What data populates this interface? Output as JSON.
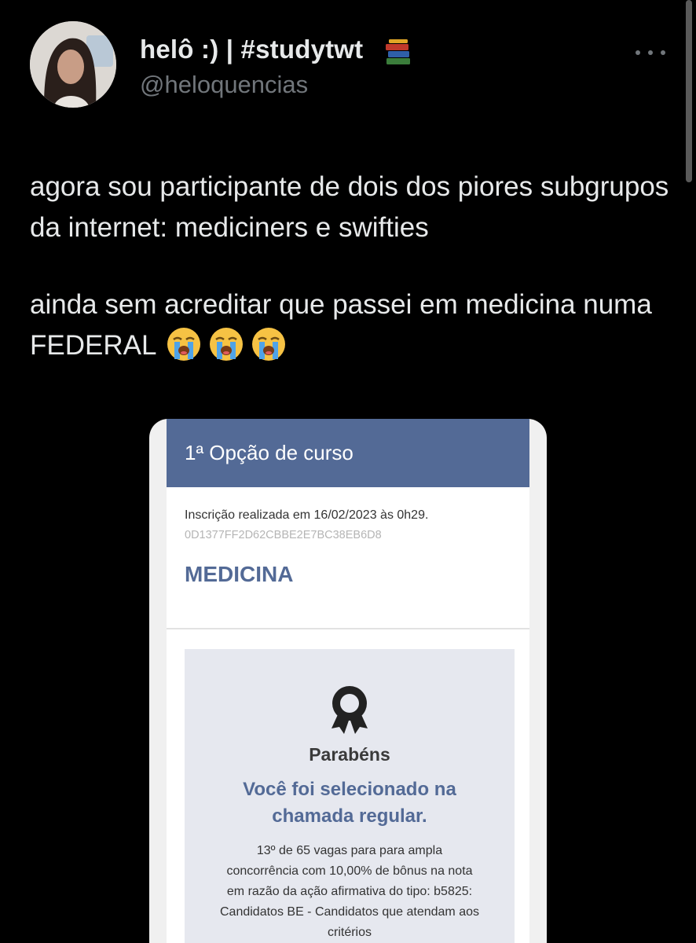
{
  "tweet": {
    "display_name": "helô :) | #studytwt",
    "handle": "@heloquencias",
    "icons": {
      "name_emoji": "books-icon",
      "menu": "more-options-icon",
      "emoji": "loudly-crying-face-icon"
    },
    "paragraph_1": "agora sou participante de dois dos piores subgrupos da internet: mediciners e swifties",
    "paragraph_2": "ainda sem acreditar que passei em medicina numa FEDERAL",
    "emoji_count": 3
  },
  "card": {
    "header_title": "1ª Opção de curso",
    "enrollment_text": "Inscrição realizada em 16/02/2023 às 0h29.",
    "hash": "0D1377FF2D62CBBE2E7BC38EB6D8",
    "course": "MEDICINA",
    "result": {
      "icon": "award-ribbon-icon",
      "congrats": "Parabéns",
      "message": "Você foi selecionado na chamada regular.",
      "details": "13º de 65 vagas para para ampla concorrência com 10,00% de bônus na nota em razão da ação afirmativa do tipo: b5825: Candidatos BE - Candidatos que atendam aos critérios"
    }
  },
  "colors": {
    "background": "#000000",
    "text": "#e7e9ea",
    "muted": "#71767b",
    "card_accent": "#536a96"
  }
}
